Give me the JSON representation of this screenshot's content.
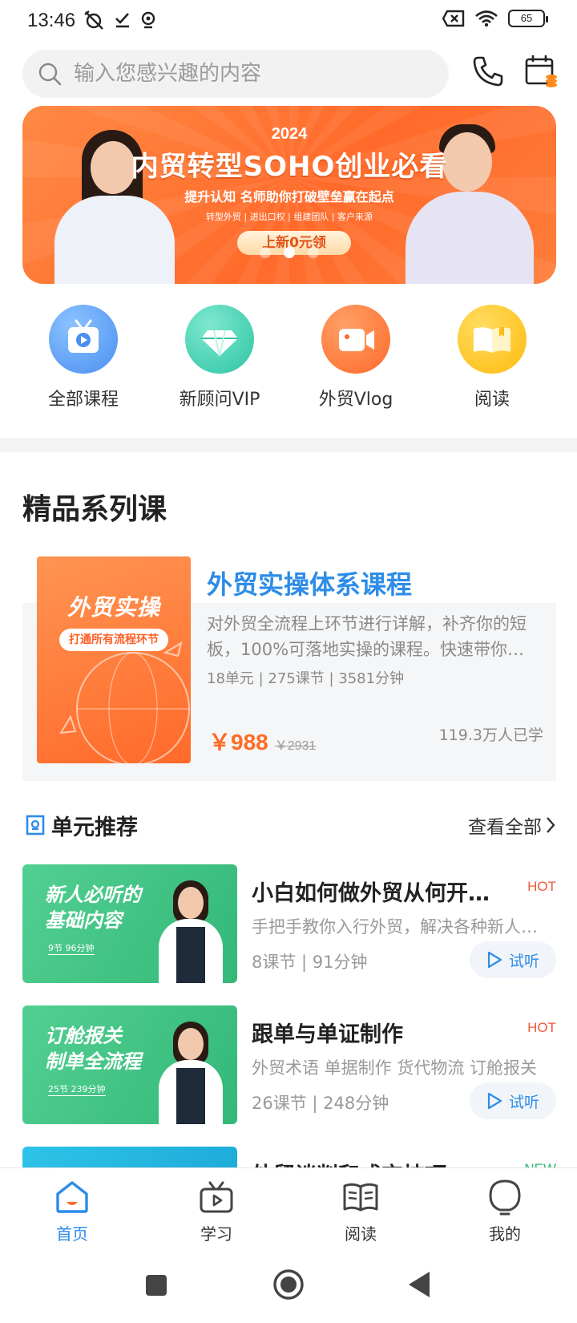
{
  "status_bar": {
    "time": "13:46",
    "battery": "65"
  },
  "search": {
    "placeholder": "输入您感兴趣的内容"
  },
  "banner": {
    "year": "2024",
    "title": "内贸转型SOHO创业必看",
    "subtitle": "提升认知 名师助你打破壁垒赢在起点",
    "tags": "转型外贸 | 进出口权 | 组建团队 | 客户来源",
    "cta": "上新0元领",
    "active_slide": 2,
    "slide_count": 3
  },
  "quick_links": [
    {
      "label": "全部课程",
      "icon": "tv-icon",
      "color": "#5aa0f0"
    },
    {
      "label": "新顾问VIP",
      "icon": "diamond-icon",
      "color": "#3fd0b0"
    },
    {
      "label": "外贸Vlog",
      "icon": "video-camera-icon",
      "color": "#ff7a33"
    },
    {
      "label": "阅读",
      "icon": "book-icon",
      "color": "#ffc21a"
    }
  ],
  "premium": {
    "section_title": "精品系列课",
    "course": {
      "cover_title": "外贸实操",
      "cover_tag": "打通所有流程环节",
      "title": "外贸实操体系课程",
      "description": "对外贸全流程上环节进行详解，补齐你的短板，100%可落地实操的课程。快速带你…",
      "meta": "18单元 | 275课节 | 3581分钟",
      "price": "￥988",
      "original_price": "￥2931",
      "learners": "119.3万人已学"
    }
  },
  "units": {
    "title": "单元推荐",
    "see_all": "查看全部",
    "items": [
      {
        "thumb_line1": "新人必听的",
        "thumb_line2": "基础内容",
        "thumb_meta": "9节 96分钟",
        "thumb_color": "#3fc58a",
        "title": "小白如何做外贸从何开…",
        "badge": "HOT",
        "desc": "手把手教你入行外贸，解决各种新人…",
        "meta": "8课节 | 91分钟",
        "try": "试听"
      },
      {
        "thumb_line1": "订舱报关",
        "thumb_line2": "制单全流程",
        "thumb_meta": "25节 239分钟",
        "thumb_color": "#3fc58a",
        "title": "跟单与单证制作",
        "badge": "HOT",
        "desc": "外贸术语 单据制作 货代物流 订舱报关",
        "meta": "26课节 | 248分钟",
        "try": "试听"
      },
      {
        "title": "外贸谈判和成交技巧",
        "badge": "NEW",
        "thumb_color": "#26b7e0"
      }
    ]
  },
  "bottom_nav": [
    {
      "label": "首页",
      "icon": "home-icon",
      "active": true
    },
    {
      "label": "学习",
      "icon": "tv-icon",
      "active": false
    },
    {
      "label": "阅读",
      "icon": "book-icon",
      "active": false
    },
    {
      "label": "我的",
      "icon": "profile-icon",
      "active": false
    }
  ]
}
